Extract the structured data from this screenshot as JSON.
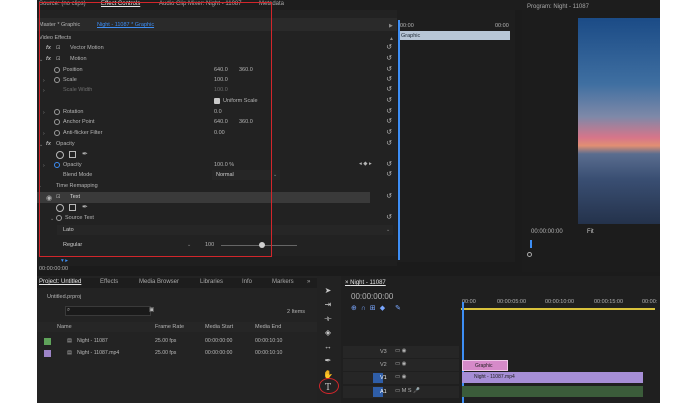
{
  "top_tabs": {
    "source": "Source: (no clips)",
    "effect_controls": "Effect Controls",
    "audio_clip_mixer": "Audio Clip Mixer: Night - 11087",
    "metadata": "Metadata",
    "program": "Program: Night - 11087"
  },
  "effect_controls": {
    "master_label": "Master * Graphic",
    "clip_label": "Night - 11087 * Graphic",
    "section_label": "Video Effects",
    "mini_timeline": {
      "start": "00:00",
      "end": "00:00",
      "clip_name": "Graphic"
    },
    "vector_motion": "Vector Motion",
    "motion": "Motion",
    "position": {
      "label": "Position",
      "x": "640.0",
      "y": "360.0"
    },
    "scale": {
      "label": "Scale",
      "value": "100.0"
    },
    "scale_width": {
      "label": "Scale Width",
      "value": "100.0"
    },
    "uniform_scale": "Uniform Scale",
    "rotation": {
      "label": "Rotation",
      "value": "0.0"
    },
    "anchor_point": {
      "label": "Anchor Point",
      "x": "640.0",
      "y": "360.0"
    },
    "anti_flicker": {
      "label": "Anti-flicker Filter",
      "value": "0.00"
    },
    "opacity_group": "Opacity",
    "opacity": {
      "label": "Opacity",
      "value": "100.0 %"
    },
    "blend_mode": {
      "label": "Blend Mode",
      "value": "Normal"
    },
    "time_remapping": "Time Remapping",
    "text_group": "Text",
    "source_text": "Source Text",
    "font_name": "Lato",
    "font_style": "Regular",
    "font_size": "100",
    "bottom_timecode": "00:00:00:00"
  },
  "program": {
    "timecode": "00:00:00:00",
    "fit": "Fit"
  },
  "project": {
    "tabs": [
      "Project: Untitled",
      "Effects",
      "Media Browser",
      "Libraries",
      "Info",
      "Markers"
    ],
    "file_name": "Untitled.prproj",
    "items_count": "2 Items",
    "columns": [
      "Name",
      "Frame Rate",
      "Media Start",
      "Media End"
    ],
    "rows": [
      {
        "name": "Night - 11087",
        "frame_rate": "25.00 fps",
        "media_start": "00:00:00:00",
        "media_end": "00:00:10:10",
        "color": "#5fa35a"
      },
      {
        "name": "Night - 11087.mp4",
        "frame_rate": "25.00 fps",
        "media_start": "00:00:00:00",
        "media_end": "00:00:10:10",
        "color": "#9d84c7"
      }
    ]
  },
  "timeline": {
    "tab": "Night - 11087",
    "timecode": "00:00:00:00",
    "ruler": [
      "00:00",
      "00:00:05:00",
      "00:00:10:00",
      "00:00:15:00",
      "00:00:"
    ],
    "tracks": [
      "V3",
      "V2",
      "V1",
      "A1"
    ],
    "graphic_clip": "Graphic",
    "video_clip": "Night - 11087.mp4"
  },
  "colors": {
    "accent_blue": "#3d8ef5",
    "highlight_red": "#d2262b",
    "graphic_clip": "#d68ac9",
    "video_clip": "#a68ed6"
  }
}
